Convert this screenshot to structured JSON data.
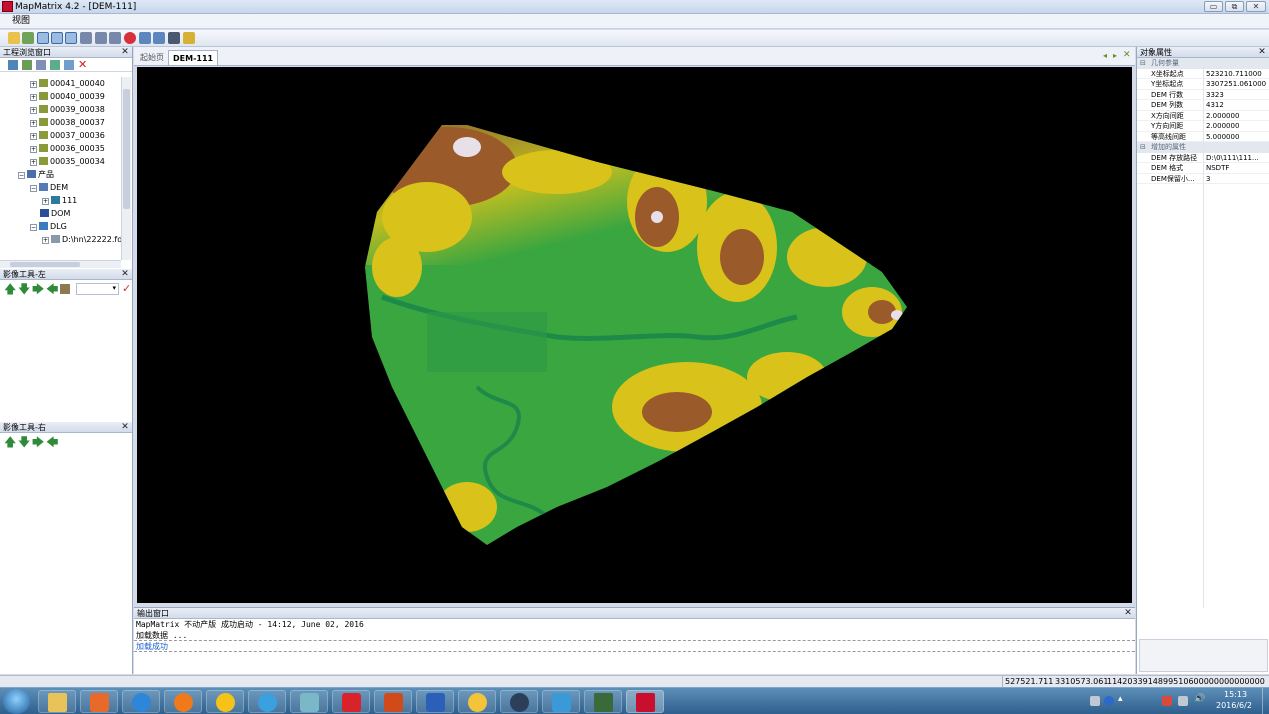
{
  "window": {
    "title": "MapMatrix 4.2 - [DEM-111]",
    "buttons": {
      "minimize": "▭",
      "restore": "⧉",
      "close": "✕"
    }
  },
  "menu": {
    "view": "视图"
  },
  "project_browser": {
    "title": "工程浏览窗口",
    "items": [
      {
        "label": "00041_00040"
      },
      {
        "label": "00040_00039"
      },
      {
        "label": "00039_00038"
      },
      {
        "label": "00038_00037"
      },
      {
        "label": "00037_00036"
      },
      {
        "label": "00036_00035"
      },
      {
        "label": "00035_00034"
      },
      {
        "label": "产品"
      },
      {
        "label": "DEM"
      },
      {
        "label": "111"
      },
      {
        "label": "DOM"
      },
      {
        "label": "DLG"
      },
      {
        "label": "D:\\hn\\22222.fdb"
      }
    ]
  },
  "image_tools_left": {
    "title": "影像工具-左"
  },
  "image_tools_right": {
    "title": "影像工具-右"
  },
  "tabs": [
    {
      "label": "起始页"
    },
    {
      "label": "DEM-111"
    }
  ],
  "output": {
    "title": "输出窗口",
    "lines": [
      "MapMatrix 不动产版  成功启动 - 14:12, June 02, 2016",
      "加载数据 ...",
      "加载成功"
    ]
  },
  "properties": {
    "title": "对象属性",
    "categories": [
      {
        "name": "几何参量",
        "rows": [
          {
            "key": "X坐标起点",
            "value": "523210.711000"
          },
          {
            "key": "Y坐标起点",
            "value": "3307251.061000"
          },
          {
            "key": "DEM 行数",
            "value": "3323"
          },
          {
            "key": "DEM 列数",
            "value": "4312"
          },
          {
            "key": "X方向间距",
            "value": "2.000000"
          },
          {
            "key": "Y方向间距",
            "value": "2.000000"
          },
          {
            "key": "等高线间距",
            "value": "5.000000"
          }
        ]
      },
      {
        "name": "增加的属性",
        "rows": [
          {
            "key": "DEM 存放路径",
            "value": "D:\\0\\111\\111..."
          },
          {
            "key": "DEM 格式",
            "value": "NSDTF"
          },
          {
            "key": "DEM保留小...",
            "value": "3"
          }
        ]
      }
    ]
  },
  "status": {
    "x": "527521.711",
    "y": "3310573.061",
    "z": "1142033914899510600000000000000"
  },
  "taskbar": {
    "time": "15:13",
    "date": "2016/6/2"
  },
  "colors": {
    "dem_low": "#3aa640",
    "dem_mid": "#d9c21a",
    "dem_high": "#9a5a2a",
    "dem_peak": "#e8e0e8"
  }
}
